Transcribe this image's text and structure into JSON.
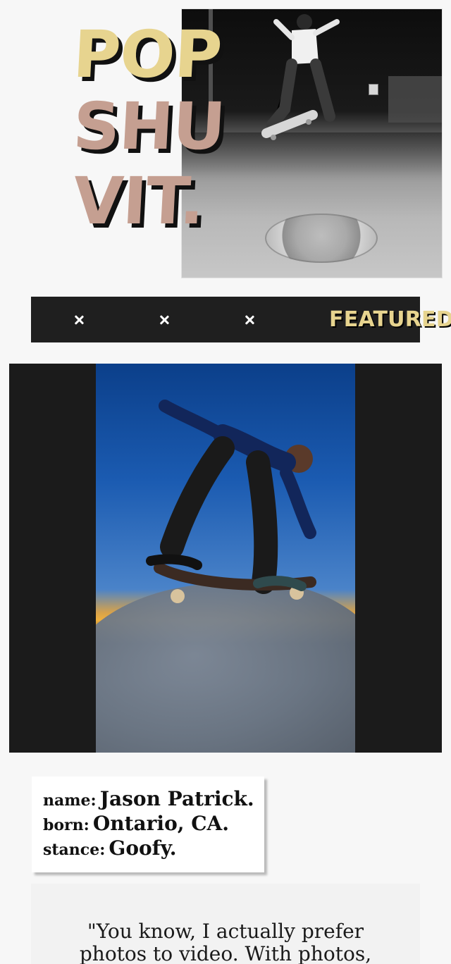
{
  "hero": {
    "title_lines": [
      "POP",
      "SHU",
      "VIT."
    ],
    "title_colors": [
      "#e7d48f",
      "#c59f91",
      "#c59f91"
    ]
  },
  "featured_bar": {
    "label": "FEATURED:",
    "icons": [
      "close-icon",
      "close-icon",
      "close-icon"
    ],
    "background": "#1f1f1f",
    "label_color": "#e7d48f"
  },
  "profile": {
    "name_key": "name:",
    "name_value": "Jason Patrick.",
    "born_key": "born:",
    "born_value": "Ontario, CA.",
    "stance_key": "stance:",
    "stance_value": "Goofy."
  },
  "quote": {
    "text_lines": [
      "\"You know, I actually prefer",
      "photos to video. With photos,"
    ]
  }
}
